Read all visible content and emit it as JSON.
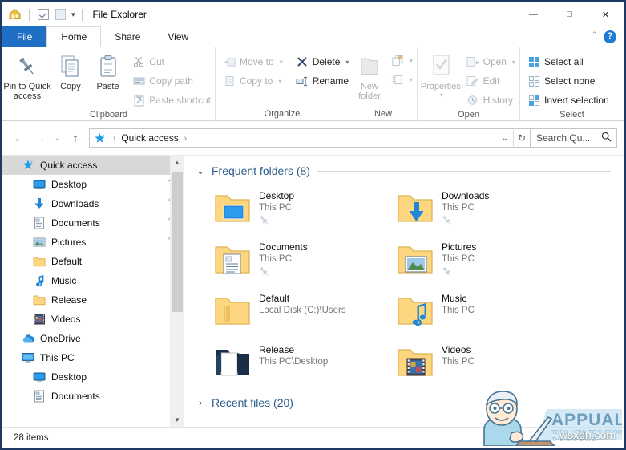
{
  "window": {
    "title": "File Explorer",
    "controls": {
      "minimize": "—",
      "maximize": "□",
      "close": "✕"
    },
    "quick_access_toolbar": [
      {
        "name": "explorer-home-icon",
        "label": ""
      },
      {
        "name": "properties-checkbox-icon",
        "label": ""
      },
      {
        "name": "new-folder-icon",
        "label": ""
      },
      {
        "name": "customize-caret-icon",
        "label": "▾"
      }
    ]
  },
  "tabs": {
    "file": "File",
    "items": [
      {
        "label": "Home",
        "active": true
      },
      {
        "label": "Share",
        "active": false
      },
      {
        "label": "View",
        "active": false
      }
    ],
    "collapse_caret": "＾",
    "help_label": "?"
  },
  "ribbon": {
    "groups": [
      {
        "label": "Clipboard",
        "big_buttons": [
          {
            "label_line1": "Pin to Quick",
            "label_line2": "access",
            "icon": "pin-icon",
            "dim": false
          },
          {
            "label_line1": "Copy",
            "label_line2": "",
            "icon": "copy-icon",
            "dim": false
          },
          {
            "label_line1": "Paste",
            "label_line2": "",
            "icon": "paste-icon",
            "dim": false
          }
        ],
        "small_buttons": [
          {
            "label": "Cut",
            "icon": "scissors-icon",
            "dim": true,
            "caret": false
          },
          {
            "label": "Copy path",
            "icon": "copy-path-icon",
            "dim": true,
            "caret": false
          },
          {
            "label": "Paste shortcut",
            "icon": "paste-shortcut-icon",
            "dim": true,
            "caret": false
          }
        ]
      },
      {
        "label": "Organize",
        "big_buttons": [],
        "small_buttons": [
          {
            "label": "Move to",
            "icon": "move-to-icon",
            "dim": true,
            "caret": true
          },
          {
            "label": "Copy to",
            "icon": "copy-to-icon",
            "dim": true,
            "caret": true
          },
          {
            "label": "Delete",
            "icon": "delete-x-icon",
            "dim": false,
            "caret": true
          },
          {
            "label": "Rename",
            "icon": "rename-icon",
            "dim": false,
            "caret": false
          }
        ]
      },
      {
        "label": "New",
        "big_buttons": [
          {
            "label_line1": "New",
            "label_line2": "folder",
            "icon": "new-folder-icon",
            "dim": true
          }
        ],
        "small_buttons": [
          {
            "label": "",
            "icon": "new-item-icon",
            "dim": true,
            "caret": true
          },
          {
            "label": "",
            "icon": "easy-access-icon",
            "dim": true,
            "caret": true
          }
        ]
      },
      {
        "label": "Open",
        "big_buttons": [
          {
            "label_line1": "Properties",
            "label_line2": "",
            "icon": "properties-icon",
            "dim": true
          }
        ],
        "small_buttons": [
          {
            "label": "Open",
            "icon": "open-icon",
            "dim": true,
            "caret": true
          },
          {
            "label": "Edit",
            "icon": "edit-icon",
            "dim": true,
            "caret": false
          },
          {
            "label": "History",
            "icon": "history-icon",
            "dim": true,
            "caret": false
          }
        ]
      },
      {
        "label": "Select",
        "big_buttons": [],
        "small_buttons": [
          {
            "label": "Select all",
            "icon": "select-all-icon",
            "dim": false,
            "caret": false
          },
          {
            "label": "Select none",
            "icon": "select-none-icon",
            "dim": false,
            "caret": false
          },
          {
            "label": "Invert selection",
            "icon": "invert-selection-icon",
            "dim": false,
            "caret": false
          }
        ]
      }
    ]
  },
  "addressbar": {
    "back": "←",
    "forward": "→",
    "recent": "⌄",
    "up": "↑",
    "breadcrumb": [
      "Quick access"
    ],
    "crumb_separator": "›",
    "dropdown": "⌄",
    "refresh": "↻",
    "search_value": "Search Qu...",
    "search_icon": "search-icon"
  },
  "navigation_pane": {
    "items": [
      {
        "label": "Quick access",
        "icon": "quick-access-star-icon",
        "indent": 0,
        "selected": true,
        "pinned": false
      },
      {
        "label": "Desktop",
        "icon": "desktop-icon",
        "indent": 1,
        "selected": false,
        "pinned": true
      },
      {
        "label": "Downloads",
        "icon": "downloads-icon",
        "indent": 1,
        "selected": false,
        "pinned": true
      },
      {
        "label": "Documents",
        "icon": "documents-icon",
        "indent": 1,
        "selected": false,
        "pinned": true
      },
      {
        "label": "Pictures",
        "icon": "pictures-icon",
        "indent": 1,
        "selected": false,
        "pinned": true
      },
      {
        "label": "Default",
        "icon": "folder-icon",
        "indent": 1,
        "selected": false,
        "pinned": false
      },
      {
        "label": "Music",
        "icon": "music-note-icon",
        "indent": 1,
        "selected": false,
        "pinned": false
      },
      {
        "label": "Release",
        "icon": "folder-icon",
        "indent": 1,
        "selected": false,
        "pinned": false
      },
      {
        "label": "Videos",
        "icon": "videos-icon",
        "indent": 1,
        "selected": false,
        "pinned": false
      },
      {
        "label": "OneDrive",
        "icon": "onedrive-cloud-icon",
        "indent": 0,
        "selected": false,
        "pinned": false
      },
      {
        "label": "This PC",
        "icon": "this-pc-icon",
        "indent": 0,
        "selected": false,
        "pinned": false
      },
      {
        "label": "Desktop",
        "icon": "desktop-icon",
        "indent": 1,
        "selected": false,
        "pinned": false
      },
      {
        "label": "Documents",
        "icon": "documents-icon",
        "indent": 1,
        "selected": false,
        "pinned": false
      }
    ]
  },
  "main": {
    "sections": [
      {
        "id": "frequent",
        "title": "Frequent folders (8)",
        "expanded": true,
        "chevron": "⌄"
      },
      {
        "id": "recent",
        "title": "Recent files (20)",
        "expanded": false,
        "chevron": "›"
      }
    ],
    "frequent_folders": [
      {
        "name": "Desktop",
        "location": "This PC",
        "icon": "folder-desktop-icon",
        "pinned": true
      },
      {
        "name": "Downloads",
        "location": "This PC",
        "icon": "folder-downloads-icon",
        "pinned": true
      },
      {
        "name": "Documents",
        "location": "This PC",
        "icon": "folder-documents-icon",
        "pinned": true
      },
      {
        "name": "Pictures",
        "location": "This PC",
        "icon": "folder-pictures-icon",
        "pinned": true
      },
      {
        "name": "Default",
        "location": "Local Disk (C:)\\Users",
        "icon": "folder-default-icon",
        "pinned": false
      },
      {
        "name": "Music",
        "location": "This PC",
        "icon": "folder-music-icon",
        "pinned": false
      },
      {
        "name": "Release",
        "location": "This PC\\Desktop",
        "icon": "folder-release-icon",
        "pinned": false
      },
      {
        "name": "Videos",
        "location": "This PC",
        "icon": "folder-videos-icon",
        "pinned": false
      }
    ]
  },
  "statusbar": {
    "item_count": "28 items"
  },
  "watermark": {
    "brand": "APPUALS",
    "tagline": "TECH HOW-TO'S FROM THE EXPERTS",
    "site": "wsxdn.com"
  },
  "colors": {
    "accent_blue": "#1f6fc4",
    "section_title": "#2b5d8b",
    "folder_yellow": "#fcd77f",
    "selection_gray": "#d8d8d8",
    "window_border": "#1d3a63"
  }
}
